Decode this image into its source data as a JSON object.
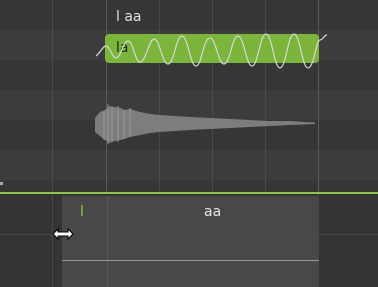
{
  "note": {
    "lyric_above": "l aa",
    "lyric_inside": "la",
    "color": "#7bb63a"
  },
  "phonemes": {
    "items": [
      "l",
      "aa"
    ],
    "first_color": "#8cc63f",
    "second_color": "#e6e6e6"
  },
  "icons": {
    "resize_cursor": "horizontal-resize-cursor-icon"
  },
  "colors": {
    "background": "#3a3a3a",
    "divider": "#8cc63f",
    "waveform": "#8a8a8a"
  }
}
